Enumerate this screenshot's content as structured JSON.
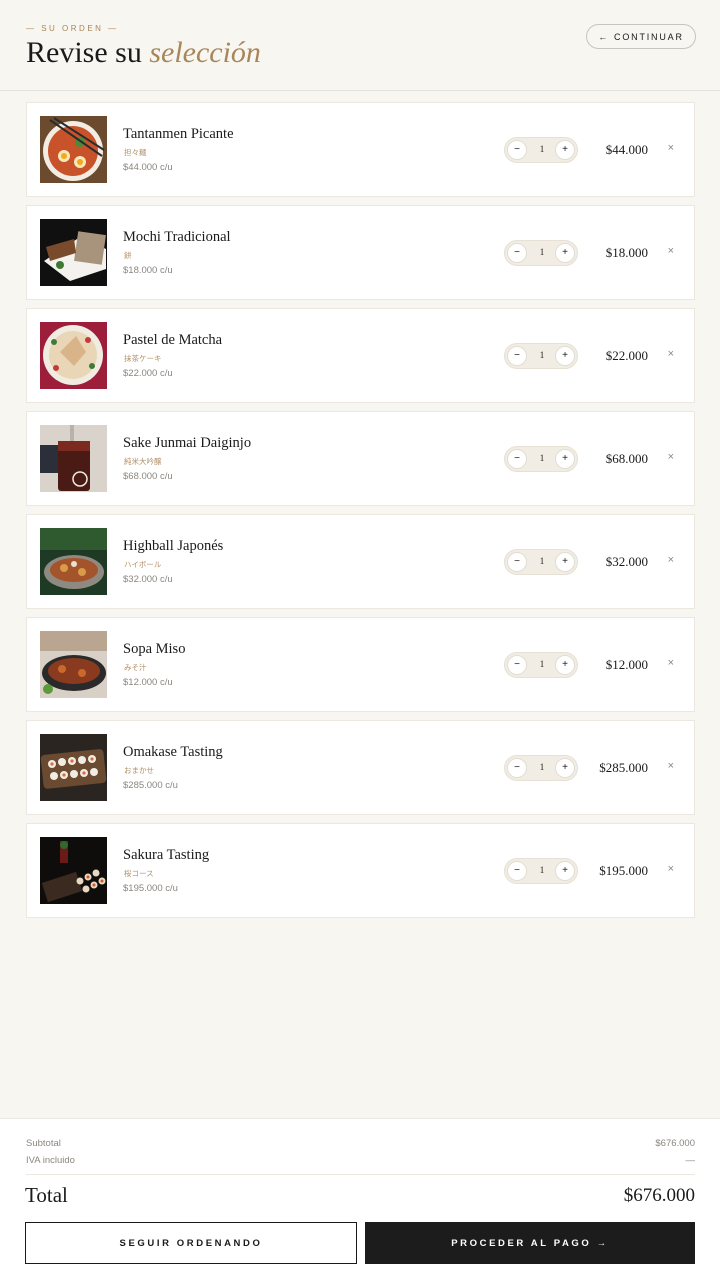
{
  "header": {
    "eyebrow": "— SU ORDEN —",
    "title_plain": "Revise su",
    "title_accent": "selección",
    "continue_arrow": "←",
    "continue_label": "CONTINUAR"
  },
  "step_controls": {
    "minus": "−",
    "plus": "+",
    "remove": "×"
  },
  "items": [
    {
      "name": "Tantanmen Picante",
      "jp": "担々麺",
      "unit_price": "$44.000 c/u",
      "qty": "1",
      "price": "$44.000"
    },
    {
      "name": "Mochi Tradicional",
      "jp": "餅",
      "unit_price": "$18.000 c/u",
      "qty": "1",
      "price": "$18.000"
    },
    {
      "name": "Pastel de Matcha",
      "jp": "抹茶ケーキ",
      "unit_price": "$22.000 c/u",
      "qty": "1",
      "price": "$22.000"
    },
    {
      "name": "Sake Junmai Daiginjo",
      "jp": "純米大吟醸",
      "unit_price": "$68.000 c/u",
      "qty": "1",
      "price": "$68.000"
    },
    {
      "name": "Highball Japonés",
      "jp": "ハイボール",
      "unit_price": "$32.000 c/u",
      "qty": "1",
      "price": "$32.000"
    },
    {
      "name": "Sopa Miso",
      "jp": "みそ汁",
      "unit_price": "$12.000 c/u",
      "qty": "1",
      "price": "$12.000"
    },
    {
      "name": "Omakase Tasting",
      "jp": "おまかせ",
      "unit_price": "$285.000 c/u",
      "qty": "1",
      "price": "$285.000"
    },
    {
      "name": "Sakura Tasting",
      "jp": "桜コース",
      "unit_price": "$195.000 c/u",
      "qty": "1",
      "price": "$195.000"
    }
  ],
  "summary": {
    "subtotal_label": "Subtotal",
    "subtotal_value": "$676.000",
    "iva_label": "IVA incluido",
    "iva_value": "—",
    "total_label": "Total",
    "total_value": "$676.000"
  },
  "actions": {
    "keep_ordering": "SEGUIR ORDENANDO",
    "checkout": "PROCEDER AL PAGO →"
  }
}
